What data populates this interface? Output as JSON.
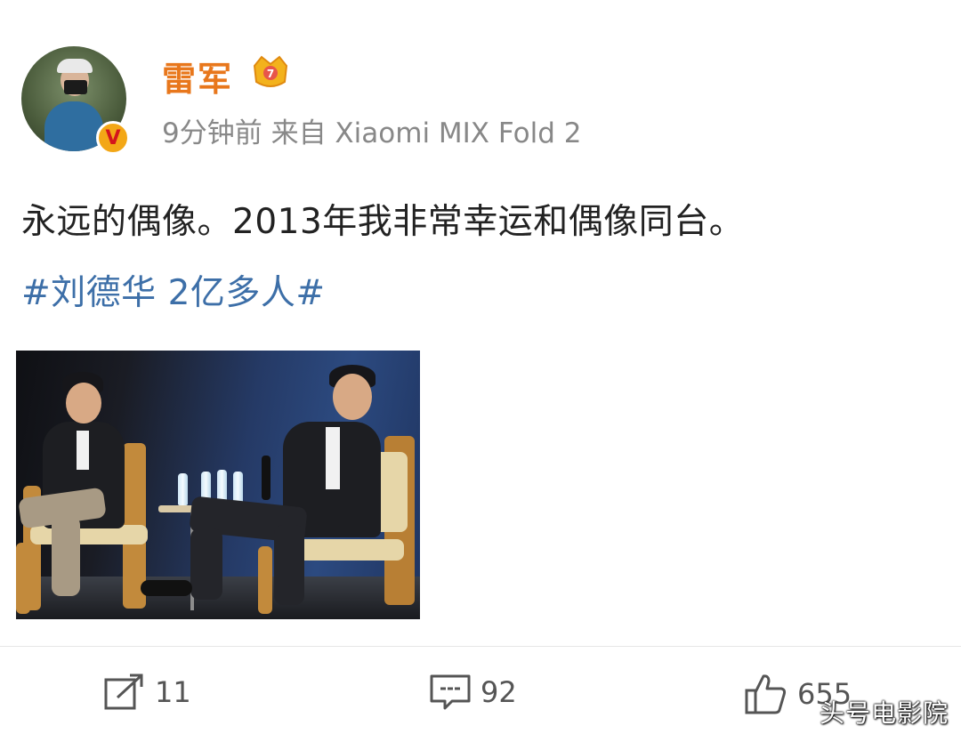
{
  "post": {
    "user": {
      "name": "雷军",
      "avatar_icon": "avatar-photo",
      "verified_badge": "V",
      "vip_icon": "crown-icon"
    },
    "meta": "9分钟前  来自 Xiaomi MIX Fold 2",
    "text": "永远的偶像。2013年我非常幸运和偶像同台。",
    "hashtag": "#刘德华 2亿多人#"
  },
  "actions": {
    "repost_count": "11",
    "comment_count": "92",
    "like_count": "655"
  },
  "watermark": "头号电影院",
  "colors": {
    "username": "#e8771c",
    "hashtag": "#3d6fa8",
    "meta": "#888888"
  }
}
